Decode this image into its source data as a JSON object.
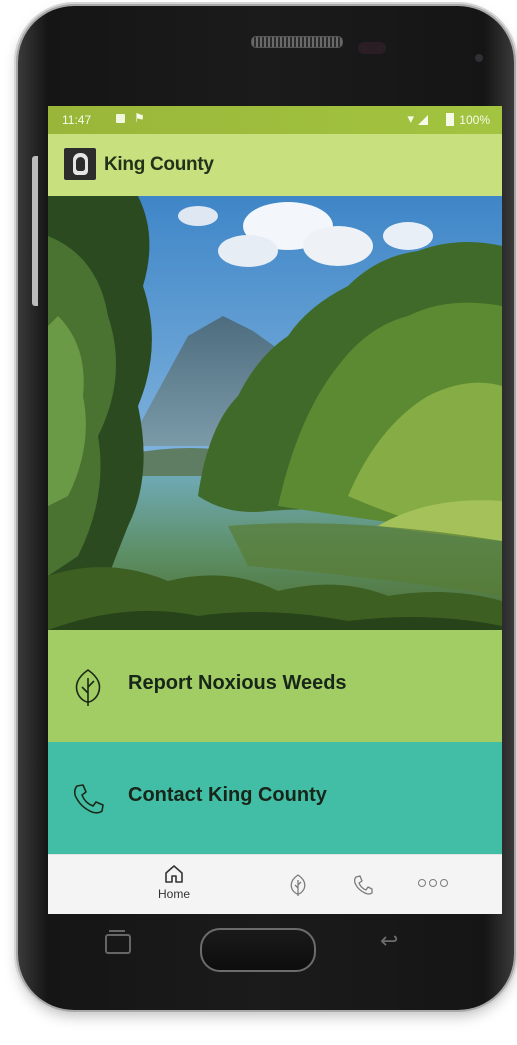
{
  "status_bar": {
    "time": "11:47",
    "battery": "100%"
  },
  "app_bar": {
    "title": "King County"
  },
  "actions": [
    {
      "label": "Report Noxious Weeds",
      "icon": "leaf-icon",
      "color": "#a2cd64"
    },
    {
      "label": "Contact King County",
      "icon": "phone-icon",
      "color": "#42bea6"
    }
  ],
  "bottom_nav": {
    "home_label": "Home",
    "items": [
      "home-icon",
      "leaf-icon",
      "phone-icon",
      "more-icon"
    ]
  },
  "colors": {
    "status_bar": "#9ab63a",
    "app_bar": "#c8e17e",
    "weeds_bg": "#a2cd64",
    "contact_bg": "#42bea6"
  }
}
